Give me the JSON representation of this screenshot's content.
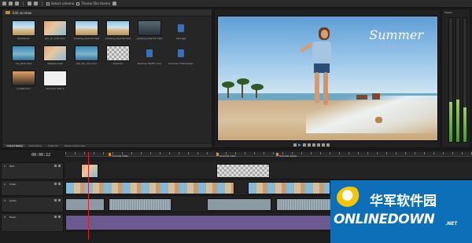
{
  "toolbar": {
    "select_scheme": "Select scheme",
    "theme": "Theme film theme"
  },
  "media_pool": {
    "header_label": "Edit window",
    "items": [
      {
        "label": "friends.avi",
        "style": "t-beach"
      },
      {
        "label": "girl_on_rock.mov",
        "style": "t-girl"
      },
      {
        "label": "jumping_beach3.mp4",
        "style": "t-beach"
      },
      {
        "label": "jumping_beach2.mp4",
        "style": "t-beach"
      },
      {
        "label": "jumping_beach1.mp4",
        "style": "t-dark"
      },
      {
        "label": "intro.jpg",
        "style": "t-icon"
      },
      {
        "label": "ice_land.mp4",
        "style": "t-water"
      },
      {
        "label": "lifestyle.mp4",
        "style": "t-girl"
      },
      {
        "label": "pull_life_mov.mov",
        "style": "t-water"
      },
      {
        "label": "Summer",
        "style": "t-checker"
      },
      {
        "label": "Summer TextFx.mov",
        "style": "t-icon"
      },
      {
        "label": "Summer Themeswav",
        "style": "t-icon"
      },
      {
        "label": "sunset.mov",
        "style": "t-sunset"
      },
      {
        "label": "Summer Title 2",
        "style": "t-white"
      }
    ],
    "tabs": [
      "Import Media",
      "Transitions",
      "Video FX",
      "Movie Looks Lazy"
    ]
  },
  "preview": {
    "title_text": "Summer"
  },
  "meter": {
    "label": "Master",
    "levels": [
      0.32,
      0.34,
      0.28
    ]
  },
  "timeline": {
    "timecode": "00:00:22",
    "markers": [
      {
        "label": "Summer Stills"
      },
      {
        "label": "Summer Intro"
      },
      {
        "label": "Summer Spots"
      }
    ],
    "tracks": [
      {
        "num": "1",
        "name": "Text"
      },
      {
        "num": "2",
        "name": "Video"
      },
      {
        "num": "3",
        "name": "Audio"
      },
      {
        "num": "4",
        "name": "Music"
      }
    ]
  },
  "watermark": {
    "cn": "华军软件园",
    "en": "ONLINEDOWN",
    "net": ".NET"
  },
  "colors": {
    "accent": "#4a90e2",
    "marker": "#e38c1f",
    "playhead": "#e02020",
    "watermark_bg": "#0d6fb8"
  }
}
